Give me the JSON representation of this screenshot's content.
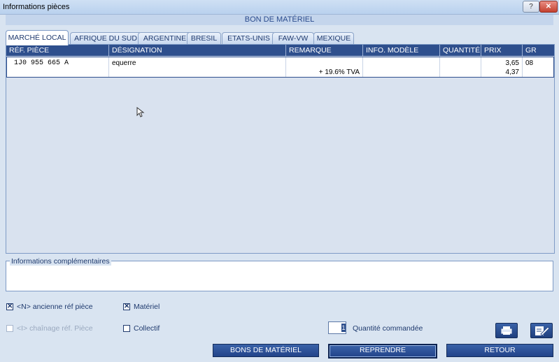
{
  "window": {
    "title": "Informations pièces",
    "help_glyph": "?",
    "close_glyph": "✕"
  },
  "header": {
    "title": "BON DE MATÉRIEL"
  },
  "tabs": [
    {
      "label": "MARCHÉ LOCAL"
    },
    {
      "label": "AFRIQUE DU SUD"
    },
    {
      "label": "ARGENTINE"
    },
    {
      "label": "BRESIL"
    },
    {
      "label": "ETATS-UNIS"
    },
    {
      "label": "FAW-VW"
    },
    {
      "label": "MEXIQUE"
    }
  ],
  "table": {
    "columns": [
      "RÉF. PIÈCE",
      "DÉSIGNATION",
      "REMARQUE",
      "INFO. MODÈLE",
      "QUANTITÉ",
      "PRIX",
      "GR"
    ],
    "row": {
      "ref": "1J0 955 665 A",
      "designation": "equerre",
      "remarque": "+ 19.6% TVA",
      "info_modele": "",
      "quantite": "",
      "prix": "3,65",
      "prix_ttc": "4,37",
      "gr": "08"
    }
  },
  "info": {
    "legend": "Informations complémentaires",
    "text": ""
  },
  "options": {
    "ancienne_ref": {
      "label": "<N> ancienne réf pièce",
      "checked": true
    },
    "chainage": {
      "label": "<I> chaînage réf. Pièce",
      "checked": false
    },
    "materiel": {
      "label": "Matériel",
      "checked": true
    },
    "collectif": {
      "label": "Collectif",
      "checked": false
    }
  },
  "quantity": {
    "value": "1",
    "label": "Quantité commandée"
  },
  "buttons": {
    "bons": "BONS DE MATÉRIEL",
    "reprendre": "REPRENDRE",
    "retour": "RETOUR"
  },
  "icons": {
    "print": "printer-icon",
    "edit": "edit-icon"
  },
  "colors": {
    "accent": "#2e4f8d",
    "background": "#d9e4f1"
  }
}
